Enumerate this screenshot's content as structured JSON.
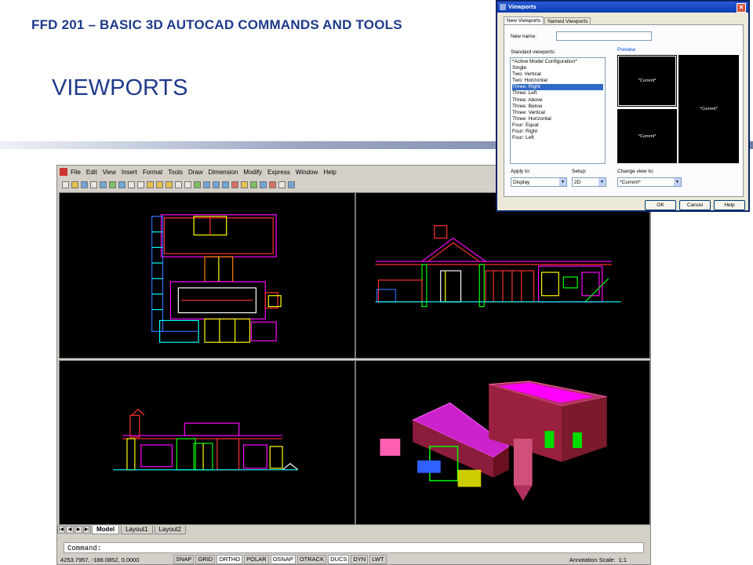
{
  "slide": {
    "title": "FFD 201 – BASIC 3D AUTOCAD COMMANDS AND TOOLS",
    "heading": "VIEWPORTS"
  },
  "autocad": {
    "menu": [
      "File",
      "Edit",
      "View",
      "Insert",
      "Format",
      "Tools",
      "Draw",
      "Dimension",
      "Modify",
      "Express",
      "Window",
      "Help"
    ],
    "layout_tabs": [
      "Model",
      "Layout1",
      "Layout2"
    ],
    "command_prompt": "Command:",
    "coordinates": "4253.7957, -188.0852, 0.0000",
    "status_toggles": [
      "SNAP",
      "GRID",
      "ORTHO",
      "POLAR",
      "OSNAP",
      "OTRACK",
      "DUCS",
      "DYN",
      "LWT"
    ],
    "annotation_scale_label": "Annotation Scale:",
    "annotation_scale_value": "1:1",
    "colors": {
      "background": "#000000",
      "magenta": "#ff00ff",
      "red": "#ff3030",
      "green": "#00ff00",
      "yellow": "#ffff00",
      "cyan": "#00ffff",
      "blue": "#3070ff"
    }
  },
  "dialog": {
    "title": "Viewports",
    "tabs": [
      "New Viewports",
      "Named Viewports"
    ],
    "new_name_label": "New name:",
    "new_name_value": "",
    "standard_viewports_label": "Standard viewports:",
    "standard_viewports": [
      "*Active Model Configuration*",
      "Single",
      "Two:  Vertical",
      "Two:  Horizontal",
      "Three: Right",
      "Three: Left",
      "Three: Above",
      "Three: Below",
      "Three: Vertical",
      "Three: Horizontal",
      "Four:  Equal",
      "Four:  Right",
      "Four:  Left"
    ],
    "selected_viewport": "Three: Right",
    "preview_label": "Preview",
    "preview_cells": [
      "*Current*",
      "*Current*",
      "*Current*"
    ],
    "apply_to_label": "Apply to:",
    "apply_to_value": "Display",
    "setup_label": "Setup:",
    "setup_value": "2D",
    "change_view_label": "Change view to:",
    "change_view_value": "*Current*",
    "buttons": {
      "ok": "OK",
      "cancel": "Cancel",
      "help": "Help"
    }
  }
}
